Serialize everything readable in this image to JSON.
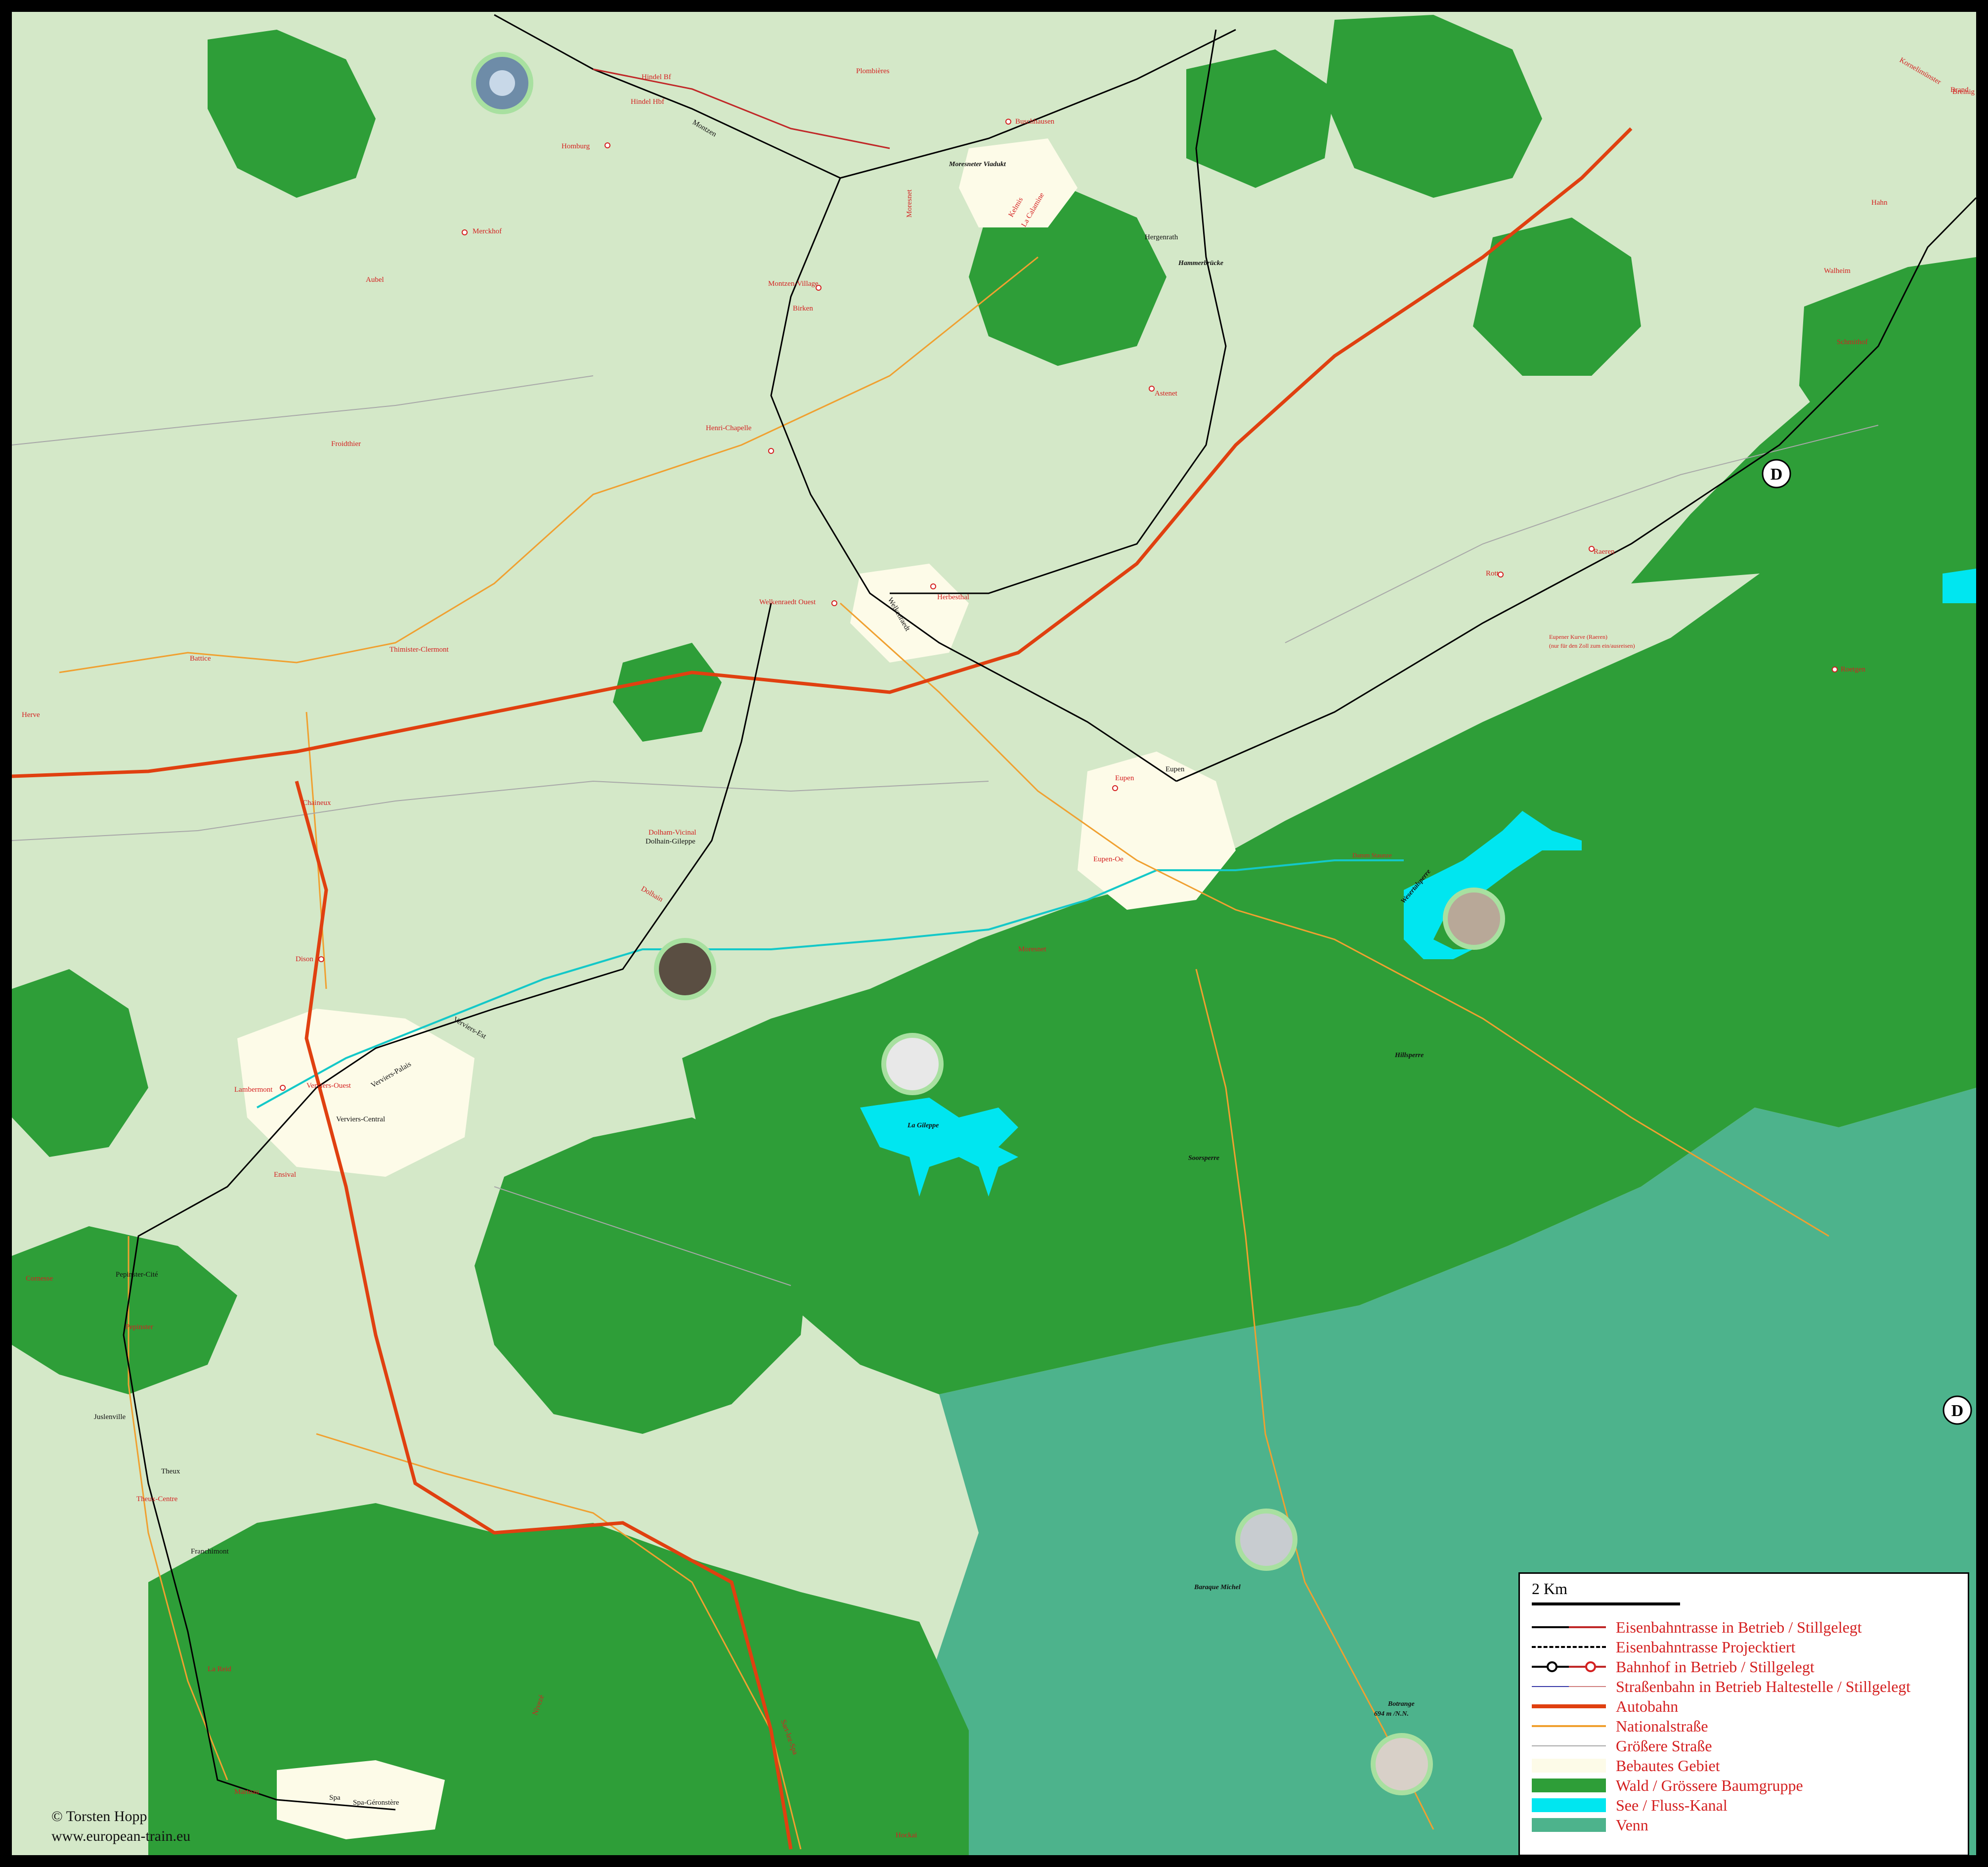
{
  "colors": {
    "background": "#d4e8c8",
    "forest": "#2e9e38",
    "venn": "#4db38c",
    "lake": "#00e6f0",
    "built": "#fdfbe8",
    "autobahn": "#e04010",
    "national": "#f0a030",
    "road": "#a8a8a8",
    "rail": "#000000",
    "disused": "#c02828",
    "label_red": "#d42020"
  },
  "places_red": [
    "Hindel Bf",
    "Hindel Hbf",
    "Plombières",
    "Homburg",
    "Buschhausen",
    "Moresnet",
    "Kelmis",
    "La Calamine",
    "Merckhof",
    "Aubel",
    "Montzen-Village",
    "Birken",
    "Henri-Chapelle",
    "Froidthier",
    "Astenet",
    "Welkenraedt Ouest",
    "Herbesthal",
    "Battice",
    "Thimister-Clermont",
    "Herve",
    "Chaineux",
    "Eupen",
    "Dolham-Vicinal",
    "Dolhain",
    "Eupen-Oe",
    "Dison",
    "Lambermont",
    "Verviers-Ouest",
    "Ensival",
    "Cornesse",
    "Pepinster",
    "Theux-Centre",
    "La Reid",
    "Marteau",
    "Nivezé",
    "Hockai",
    "Roetgen",
    "Raeren",
    "Rott",
    "Walheim",
    "Hahn",
    "Brand",
    "Kornelimünster",
    "Breinig",
    "Schmithof",
    "Moresnet",
    "Sart-lez-Spa"
  ],
  "places_black": [
    "Montzen",
    "Hergenrath",
    "Welkenraedt",
    "Eupen",
    "Dolhain-Gileppe",
    "Verviers-Palais",
    "Verviers-Est",
    "Verviers-Central",
    "Pepinster-Cité",
    "Juslenville",
    "Theux",
    "Franchimont",
    "Spa",
    "Spa-Géronstère"
  ],
  "features": {
    "viaduct": "Moresneter Viadukt",
    "bridge": "Hammerbrücke",
    "wesertal": "Wesertalsperre",
    "gileppe": "La Gileppe",
    "soor": "Soorsperre",
    "hill": "Hillsperre",
    "baraque": "Baraque Michel",
    "botrange": "Botrange",
    "botrange_alt": "694 m /N.N.",
    "raeren_note_1": "Eupener Kurve (Raeren)",
    "raeren_note_2": "(nur für den Zoll zum ein/ausreisen)",
    "dam": "Damm Staunze",
    "border_1": "D",
    "border_2": "D"
  },
  "legend": {
    "scale": "2 Km",
    "items": [
      "Eisenbahntrasse in Betrieb / Stillgelegt",
      "Eisenbahntrasse Projecktiert",
      "Bahnhof in Betrieb / Stillgelegt",
      "Straßenbahn in Betrieb Haltestelle / Stillgelegt",
      "Autobahn",
      "Nationalstraße",
      "Größere Straße",
      "Bebautes Gebiet",
      "Wald / Grössere Baumgruppe",
      "See / Fluss-Kanal",
      "Venn"
    ]
  },
  "credit": {
    "line1": "© Torsten Hopp",
    "line2": "www.european-train.eu"
  }
}
